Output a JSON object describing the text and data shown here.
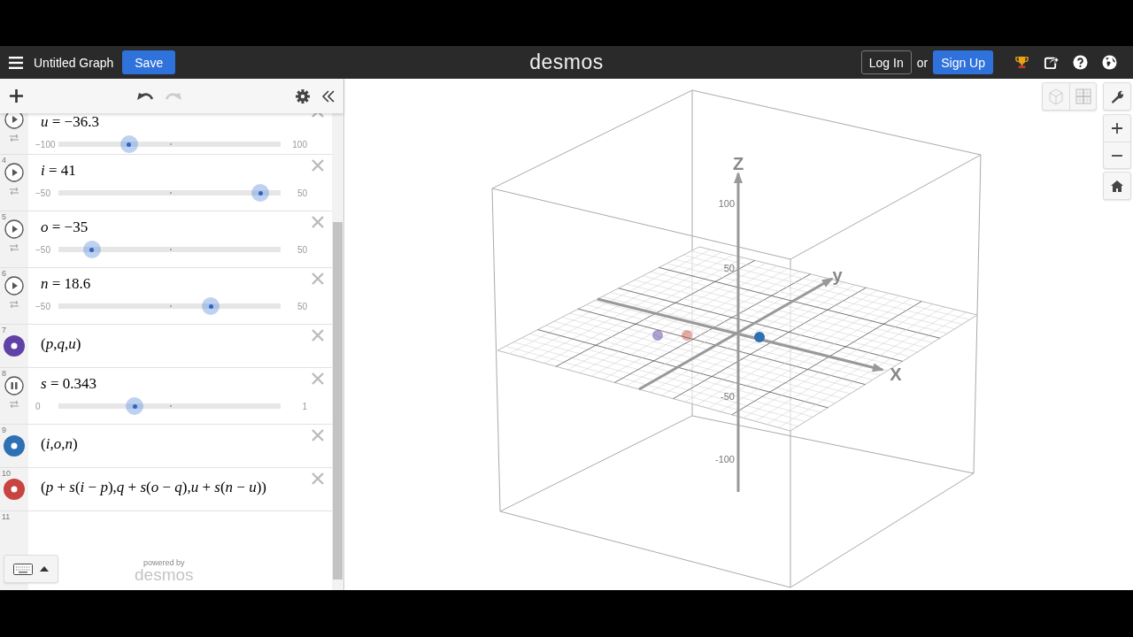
{
  "header": {
    "title": "Untitled Graph",
    "save": "Save",
    "logo": "desmos",
    "login": "Log In",
    "or": "or",
    "signup": "Sign Up"
  },
  "expressions": [
    {
      "kind": "slider",
      "expression": "*u* = −36.3",
      "playing": false,
      "min": "−100",
      "max": "100",
      "level": 0.318
    },
    {
      "kind": "slider",
      "number": "4",
      "expression": "*i* = 41",
      "playing": false,
      "min": "−50",
      "max": "50",
      "level": 0.91
    },
    {
      "kind": "slider",
      "number": "5",
      "expression": "*o* = −35",
      "playing": false,
      "min": "−50",
      "max": "50",
      "level": 0.15
    },
    {
      "kind": "slider",
      "number": "6",
      "expression": "*n* = 18.6",
      "playing": false,
      "min": "−50",
      "max": "50",
      "level": 0.686
    },
    {
      "kind": "point",
      "number": "7",
      "expression": "(*p*,*q*,*u*)",
      "color": "#6042a6"
    },
    {
      "kind": "slider",
      "number": "8",
      "expression": "*s* = 0.343",
      "playing": true,
      "min": "0",
      "max": "1",
      "level": 0.343
    },
    {
      "kind": "point",
      "number": "9",
      "expression": "(*i*,*o*,*n*)",
      "color": "#2d70b3"
    },
    {
      "kind": "point",
      "number": "10",
      "expression": "(*p* + *s*(*i* − *p*),*q* + *s*(*o* − *q*),*u* + *s*(*n* − *u*))",
      "color": "#c74440"
    },
    {
      "kind": "empty",
      "number": "11"
    }
  ],
  "footer": {
    "powered_by": "powered by",
    "logo": "desmos"
  },
  "graph": {
    "z_label": "Z",
    "y_label": "y",
    "x_label": "X",
    "z_ticks": [
      "100",
      "50",
      "-50",
      "-100"
    ]
  }
}
